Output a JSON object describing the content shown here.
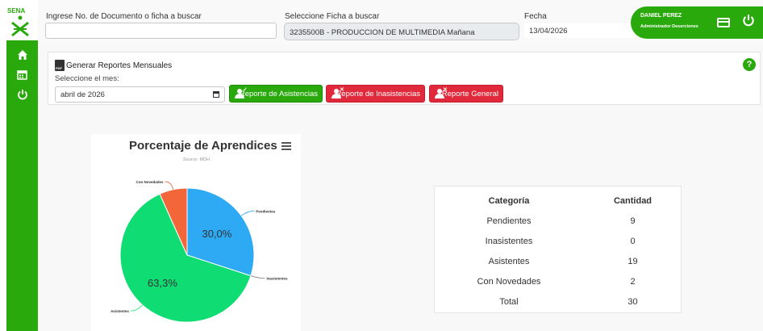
{
  "brand": {
    "logo_text": "SENA"
  },
  "search": {
    "doc_label": "Ingrese No. de Documento o ficha a buscar",
    "doc_value": "",
    "ficha_label": "Seleccione Ficha a buscar",
    "ficha_value": "3235500B - PRODUCCION DE MULTIMEDIA Mañana",
    "fecha_label": "Fecha",
    "fecha_value": "13/04/2026"
  },
  "user": {
    "name": "DANIEL PEREZ",
    "role": "Administrador Deserciones"
  },
  "reports": {
    "title": "Generar Reportes Mensuales",
    "month_label": "Seleccione el mes:",
    "month_value": "abril de 2026",
    "btn_asistencias": "Reporte de Asistencias",
    "btn_inasistencias": "Reporte de Inasistencias",
    "btn_general": "Reporte General",
    "pdf_icon_text": "PDF"
  },
  "chart_data": {
    "type": "pie",
    "title": "Porcentaje de Aprendices",
    "subtitle": "Source: MDH",
    "slices": [
      {
        "name": "Pendientes",
        "value": 30.0,
        "color": "#2eaaf5"
      },
      {
        "name": "Inasistentes",
        "value": 0.0,
        "color": "#7a7a7a"
      },
      {
        "name": "Asistentes",
        "value": 63.3,
        "color": "#0fdc72"
      },
      {
        "name": "Con Novedades",
        "value": 6.7,
        "color": "#f2663a"
      }
    ],
    "data_labels": [
      "30,0%",
      "63,3%"
    ]
  },
  "table": {
    "headers": [
      "Categoría",
      "Cantidad"
    ],
    "rows": [
      [
        "Pendientes",
        "9"
      ],
      [
        "Inasistentes",
        "0"
      ],
      [
        "Asistentes",
        "19"
      ],
      [
        "Con Novedades",
        "2"
      ],
      [
        "Total",
        "30"
      ]
    ]
  },
  "colors": {
    "brand_green": "#2aa90d",
    "danger_red": "#e02a3b"
  }
}
